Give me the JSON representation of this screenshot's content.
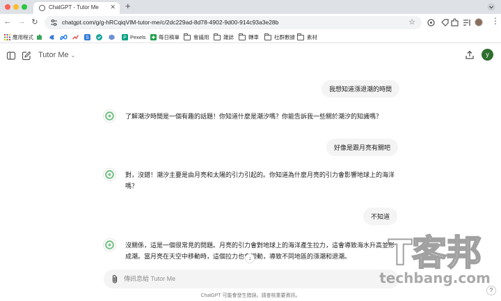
{
  "browser": {
    "tab_title": "ChatGPT - Tutor Me",
    "new_tab_symbol": "+",
    "url": "chatgpt.com/g/g-hRCqiqVlM-tutor-me/c/2dc229ad-8d78-4902-9d00-914c93a3e28b",
    "bookmarks": [
      {
        "label": "應用程式",
        "type": "apps"
      },
      {
        "label": "",
        "type": "icon-green"
      },
      {
        "label": "",
        "type": "icon-blue"
      },
      {
        "label": "",
        "type": "icon-meta"
      },
      {
        "label": "",
        "type": "icon-chart"
      },
      {
        "label": "",
        "type": "icon-S"
      },
      {
        "label": "",
        "type": "icon-cube"
      },
      {
        "label": "Pexels",
        "type": "pexels"
      },
      {
        "label": "每日稿單",
        "type": "green-plus"
      },
      {
        "label": "會議用",
        "type": "folder"
      },
      {
        "label": "雜誌",
        "type": "folder"
      },
      {
        "label": "轉車",
        "type": "folder"
      },
      {
        "label": "社群數據",
        "type": "folder"
      },
      {
        "label": "素材",
        "type": "folder"
      }
    ]
  },
  "app": {
    "model_name": "Tutor Me",
    "avatar_letter": "y",
    "composer_placeholder": "傳訊息給 Tutor Me",
    "footer_note": "ChatGPT 可能會發生錯誤。請查核重要資訊。",
    "help_label": "?",
    "scroll_down_symbol": "↓"
  },
  "messages": [
    {
      "role": "user",
      "text": "我想知道漲退潮的時間"
    },
    {
      "role": "assistant",
      "text": "了解潮汐時間是一個有趣的話題！你知道什麼是潮汐嗎？你能告訴我一些關於潮汐的知識嗎？"
    },
    {
      "role": "user",
      "text": "好像是跟月亮有關吧"
    },
    {
      "role": "assistant",
      "text": "對，沒錯！潮汐主要是由月亮和太陽的引力引起的。你知道為什麼月亮的引力會影響地球上的海洋嗎？"
    },
    {
      "role": "user",
      "text": "不知道"
    },
    {
      "role": "assistant",
      "text": "沒關係，這是一個很常見的問題。月亮的引力會對地球上的海洋產生拉力，這會導致海水升高並形成潮。當月亮在天空中移動時，這個拉力也會變動，導致不同地區的漲潮和退潮。"
    }
  ],
  "watermark": {
    "line1": "T客邦",
    "line2": "techbang.com"
  },
  "colors": {
    "avatar_bg": "#2e6e2e",
    "gpt_logo": "#7bc28a",
    "bubble_bg": "#f4f4f4"
  }
}
